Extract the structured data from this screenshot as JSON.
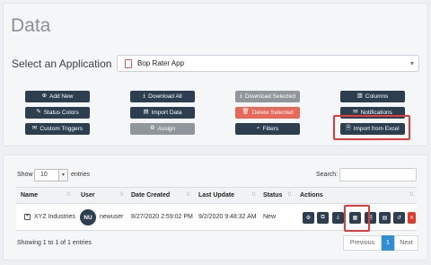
{
  "page_title": "Data",
  "select_app": {
    "label": "Select an Application",
    "value": "Bop Rater App"
  },
  "toolbar": {
    "add_new": "Add New",
    "download_all": "Download All",
    "download_selected": "Download Selected",
    "columns": "Columns",
    "status_colors": "Status Colors",
    "import_data": "Import Data",
    "delete_selected": "Delete Selected",
    "notifications": "Notifications",
    "custom_triggers": "Custom Triggers",
    "assign": "Assign",
    "filters": "Filters",
    "import_excel": "Import from Excel"
  },
  "colors": {
    "navy": "#2c3e50",
    "gray": "#8f969c",
    "red": "#e8695a",
    "highlight": "#e33b3b",
    "page_active": "#2e8ed8"
  },
  "table": {
    "show_label": "Show",
    "page_size": "10",
    "entries_label": "entries",
    "search_label": "Search:",
    "columns": [
      "Name",
      "User",
      "Date Created",
      "Last Update",
      "Status",
      "Actions"
    ],
    "rows": [
      {
        "name": "XYZ Industries",
        "avatar": "NU",
        "user": "newuser",
        "created": "8/27/2020 2:59:02 PM",
        "updated": "9/2/2020 9:48:32 AM",
        "status": "New"
      }
    ],
    "action_icons": [
      "gear-icon",
      "copy-icon",
      "download-icon",
      "excel-icon",
      "document-icon",
      "calendar-icon",
      "undo-icon",
      "close-icon"
    ],
    "summary": "Showing 1 to 1 of 1 entries"
  },
  "pagination": {
    "previous": "Previous",
    "page": "1",
    "next": "Next"
  }
}
